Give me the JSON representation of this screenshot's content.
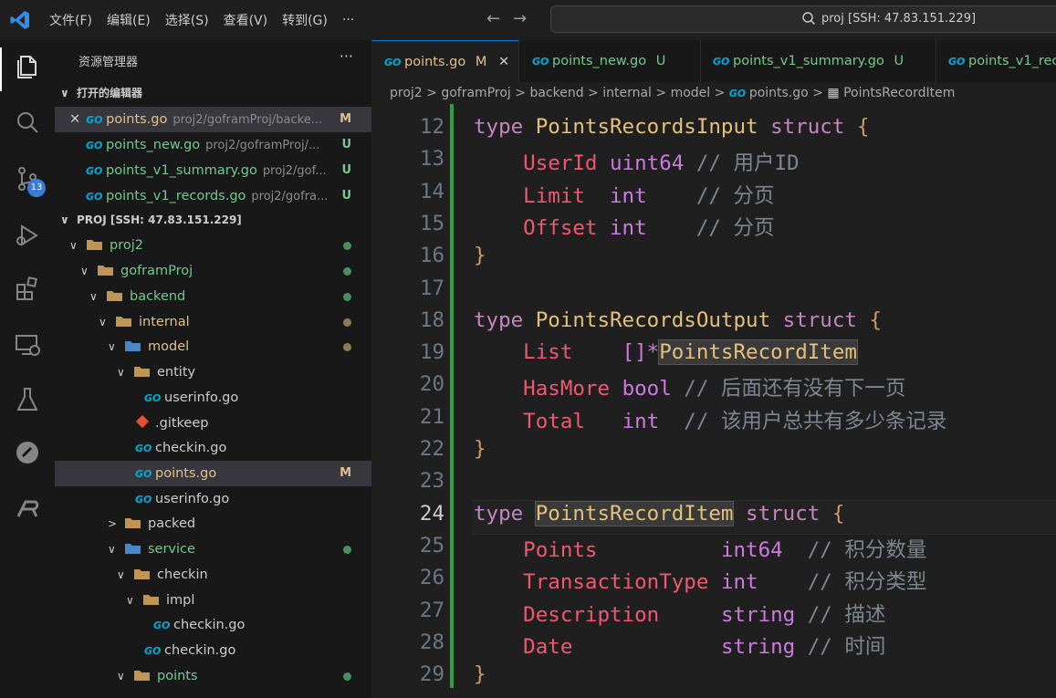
{
  "menu": [
    "文件(F)",
    "编辑(E)",
    "选择(S)",
    "查看(V)",
    "转到(G)",
    "···"
  ],
  "nav": {
    "back": "←",
    "forward": "→"
  },
  "search": {
    "text": "proj [SSH: 47.83.151.229]"
  },
  "activity": {
    "scm_badge": "13"
  },
  "sidebar": {
    "title": "资源管理器",
    "more": "···",
    "open_editors_label": "打开的编辑器",
    "open_editors": [
      {
        "name": "points.go",
        "path": "proj2/goframProj/backe...",
        "status": "M"
      },
      {
        "name": "points_new.go",
        "path": "proj2/goframProj/...",
        "status": "U"
      },
      {
        "name": "points_v1_summary.go",
        "path": "proj2/gof...",
        "status": "U"
      },
      {
        "name": "points_v1_records.go",
        "path": "proj2/gofra...",
        "status": "U"
      }
    ],
    "workspace_label": "PROJ [SSH: 47.83.151.229]",
    "tree": [
      {
        "name": "proj2"
      },
      {
        "name": "goframProj"
      },
      {
        "name": "backend"
      },
      {
        "name": "internal"
      },
      {
        "name": "model"
      },
      {
        "name": "entity"
      },
      {
        "name": "userinfo.go"
      },
      {
        "name": ".gitkeep"
      },
      {
        "name": "checkin.go"
      },
      {
        "name": "points.go",
        "status": "M"
      },
      {
        "name": "userinfo.go"
      },
      {
        "name": "packed"
      },
      {
        "name": "service"
      },
      {
        "name": "checkin"
      },
      {
        "name": "impl"
      },
      {
        "name": "checkin.go"
      },
      {
        "name": "checkin.go"
      },
      {
        "name": "points"
      }
    ]
  },
  "tabs": [
    {
      "name": "points.go",
      "status": "M",
      "close": "✕"
    },
    {
      "name": "points_new.go",
      "status": "U"
    },
    {
      "name": "points_v1_summary.go",
      "status": "U"
    },
    {
      "name": "points_v1_rec",
      "status": ""
    }
  ],
  "breadcrumb": [
    "proj2",
    "goframProj",
    "backend",
    "internal",
    "model",
    "points.go",
    "PointsRecordItem"
  ],
  "code": {
    "lines": [
      {
        "n": "12",
        "tokens": [
          [
            "k",
            "type "
          ],
          [
            "t",
            "PointsRecordsInput"
          ],
          [
            "k",
            " struct "
          ],
          [
            "p",
            "{"
          ]
        ]
      },
      {
        "n": "13",
        "tokens": [
          [
            "f",
            "    UserId "
          ],
          [
            "kt",
            "uint64"
          ],
          [
            "c",
            " // 用户ID"
          ]
        ]
      },
      {
        "n": "14",
        "tokens": [
          [
            "f",
            "    Limit  "
          ],
          [
            "kt",
            "int"
          ],
          [
            "c",
            "    // 分页"
          ]
        ]
      },
      {
        "n": "15",
        "tokens": [
          [
            "f",
            "    Offset "
          ],
          [
            "kt",
            "int"
          ],
          [
            "c",
            "    // 分页"
          ]
        ]
      },
      {
        "n": "16",
        "tokens": [
          [
            "p",
            "}"
          ]
        ]
      },
      {
        "n": "17",
        "tokens": []
      },
      {
        "n": "18",
        "tokens": [
          [
            "k",
            "type "
          ],
          [
            "t",
            "PointsRecordsOutput"
          ],
          [
            "k",
            " struct "
          ],
          [
            "p",
            "{"
          ]
        ]
      },
      {
        "n": "19",
        "tokens": [
          [
            "f",
            "    List    "
          ],
          [
            "kt",
            "[]*"
          ],
          [
            "t",
            "PointsRecordItem"
          ]
        ]
      },
      {
        "n": "20",
        "tokens": [
          [
            "f",
            "    HasMore "
          ],
          [
            "kt",
            "bool"
          ],
          [
            "c",
            " // 后面还有没有下一页"
          ]
        ]
      },
      {
        "n": "21",
        "tokens": [
          [
            "f",
            "    Total   "
          ],
          [
            "kt",
            "int"
          ],
          [
            "c",
            "  // 该用户总共有多少条记录"
          ]
        ]
      },
      {
        "n": "22",
        "tokens": [
          [
            "p",
            "}"
          ]
        ]
      },
      {
        "n": "23",
        "tokens": []
      },
      {
        "n": "24",
        "tokens": [
          [
            "k",
            "type "
          ],
          [
            "t",
            "PointsRecordItem"
          ],
          [
            "k",
            " struct "
          ],
          [
            "p",
            "{"
          ]
        ]
      },
      {
        "n": "25",
        "tokens": [
          [
            "f",
            "    Points          "
          ],
          [
            "kt",
            "int64"
          ],
          [
            "c",
            "  // 积分数量"
          ]
        ]
      },
      {
        "n": "26",
        "tokens": [
          [
            "f",
            "    TransactionType "
          ],
          [
            "kt",
            "int"
          ],
          [
            "c",
            "    // 积分类型"
          ]
        ]
      },
      {
        "n": "27",
        "tokens": [
          [
            "f",
            "    Description     "
          ],
          [
            "kt",
            "string"
          ],
          [
            "c",
            " // 描述"
          ]
        ]
      },
      {
        "n": "28",
        "tokens": [
          [
            "f",
            "    Date            "
          ],
          [
            "kt",
            "string"
          ],
          [
            "c",
            " // 时间"
          ]
        ]
      },
      {
        "n": "29",
        "tokens": [
          [
            "p",
            "}"
          ]
        ]
      }
    ]
  }
}
